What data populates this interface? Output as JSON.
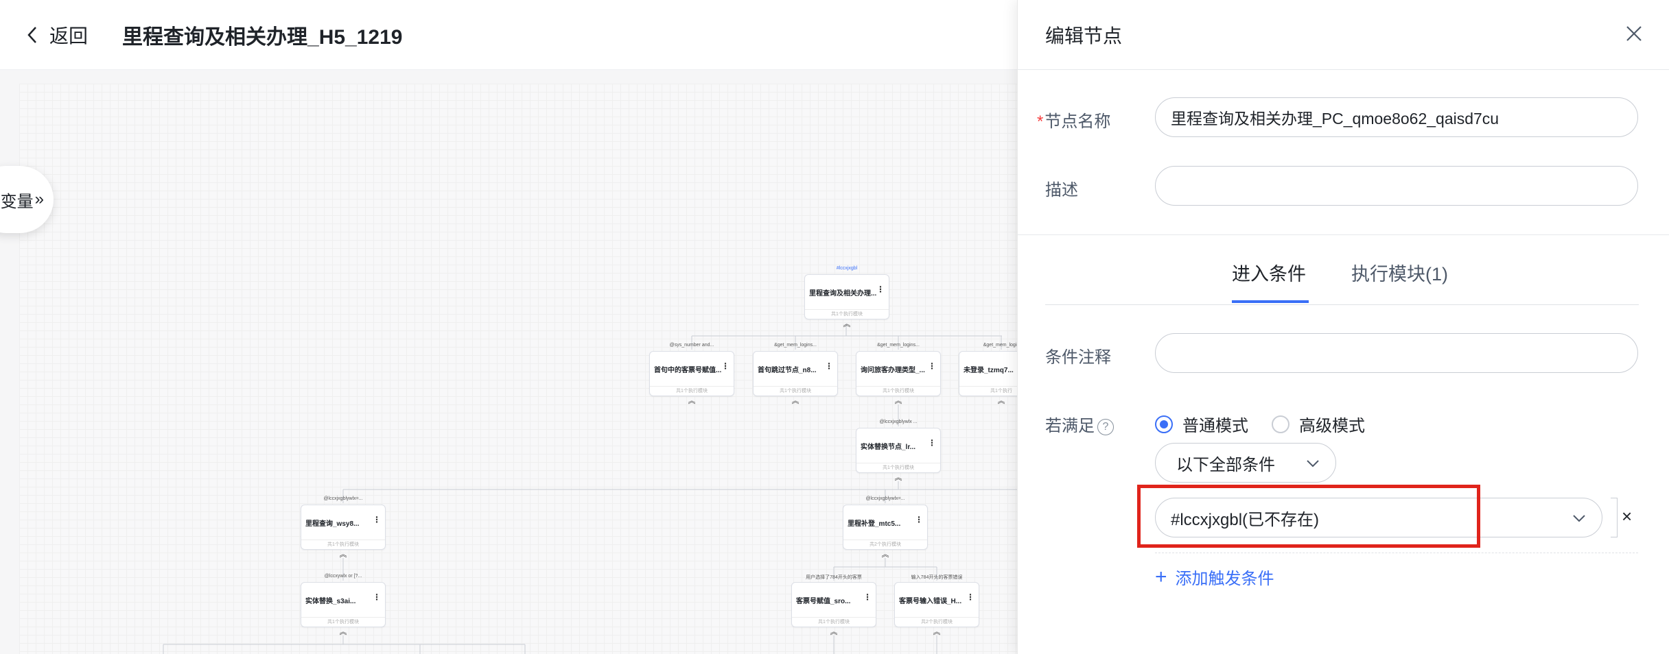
{
  "header": {
    "back_label": "返回",
    "title": "里程查询及相关办理_H5_1219"
  },
  "canvas": {
    "variables_label": "变量",
    "variables_chevron": "»",
    "expand_glyph": "︽",
    "nodes": [
      {
        "id": "root",
        "cond": "#lccxjxgbl",
        "name": "里程查询及相关办理...",
        "footer": "共1个执行模块"
      },
      {
        "id": "n1",
        "cond": "@sys_number and...",
        "name": "首句中的客票号赋值...",
        "footer": "共1个执行模块"
      },
      {
        "id": "n2",
        "cond": "&get_mem_logins...",
        "name": "首句跳过节点_n8...",
        "footer": "共1个执行模块"
      },
      {
        "id": "n3",
        "cond": "&get_mem_logins...",
        "name": "询问旅客办理类型_...",
        "footer": "共1个执行模块"
      },
      {
        "id": "n4",
        "cond": "&get_mem_login",
        "name": "未登录_tzmq7...",
        "footer": "共1个执行"
      },
      {
        "id": "n5",
        "cond": "@lccxjxgblywlx ...",
        "name": "实体替换节点_lr...",
        "footer": "共1个执行模块"
      },
      {
        "id": "n6",
        "cond": "@lccxjxgblywlx=...",
        "name": "里程查询_wsy8...",
        "footer": "共1个执行模块"
      },
      {
        "id": "n7",
        "cond": "@lccxjxgblywlx=...",
        "name": "里程补登_mtc5...",
        "footer": "共2个执行模块"
      },
      {
        "id": "n8",
        "cond": "@lccxywlx or [?...",
        "name": "实体替换_s3ai...",
        "footer": "共1个执行模块"
      },
      {
        "id": "n9",
        "cond": "用户选择了784开头的客票",
        "name": "客票号赋值_sro...",
        "footer": "共1个执行模块"
      },
      {
        "id": "n10",
        "cond": "输入784开头的客票错误",
        "name": "客票号输入错误_H...",
        "footer": "共2个执行模块"
      }
    ]
  },
  "panel": {
    "title": "编辑节点",
    "name_label": "节点名称",
    "name_value": "里程查询及相关办理_PC_qmoe8o62_qaisd7cu",
    "desc_label": "描述",
    "desc_value": "",
    "tabs": [
      {
        "label": "进入条件"
      },
      {
        "label": "执行模块(1)"
      }
    ],
    "cond_note_label": "条件注释",
    "cond_note_value": "",
    "satisfy_label": "若满足",
    "help_glyph": "?",
    "mode_normal": "普通模式",
    "mode_advanced": "高级模式",
    "match_select": "以下全部条件",
    "condition_value": "#lccxjxgbl(已不存在)",
    "remove_glyph": "×",
    "add_glyph": "+",
    "add_trigger": "添加触发条件"
  },
  "colors": {
    "accent": "#3a6ff7",
    "highlight_box": "#e0241b",
    "required": "#f53f3f"
  }
}
